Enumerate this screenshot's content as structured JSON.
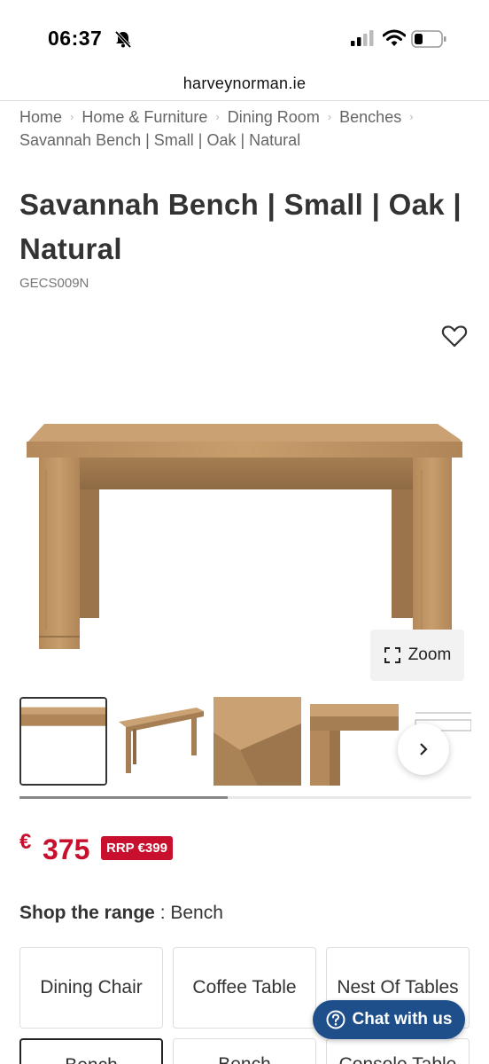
{
  "status_bar": {
    "time": "06:37"
  },
  "browser": {
    "url": "harveynorman.ie"
  },
  "breadcrumb": [
    {
      "label": "Home"
    },
    {
      "label": "Home & Furniture"
    },
    {
      "label": "Dining Room"
    },
    {
      "label": "Benches"
    },
    {
      "label": "Savannah Bench | Small | Oak | Natural"
    }
  ],
  "product": {
    "title": "Savannah Bench | Small | Oak | Natural",
    "sku": "GECS009N",
    "zoom_label": "Zoom",
    "gallery_progress": 0.46,
    "thumbnail_count": 5,
    "active_thumbnail": 1
  },
  "price": {
    "currency": "€",
    "amount": "375",
    "rrp": "RRP €399"
  },
  "range": {
    "label": "Shop the range",
    "separator": " : ",
    "value": "Bench",
    "options": [
      {
        "label": "Dining Chair"
      },
      {
        "label": "Coffee Table"
      },
      {
        "label": "Nest Of Tables"
      },
      {
        "label": "Bench"
      },
      {
        "label": "Bench"
      },
      {
        "label": "Console Table"
      }
    ]
  },
  "chat": {
    "label": "Chat with us"
  },
  "colors": {
    "accent_red": "#c8102e",
    "chat_blue": "#1e4f8a"
  },
  "icons": [
    "bell-muted-icon",
    "signal-icon",
    "wifi-icon",
    "battery-icon",
    "heart-icon",
    "zoom-icon",
    "chevron-right-icon",
    "question-icon"
  ]
}
